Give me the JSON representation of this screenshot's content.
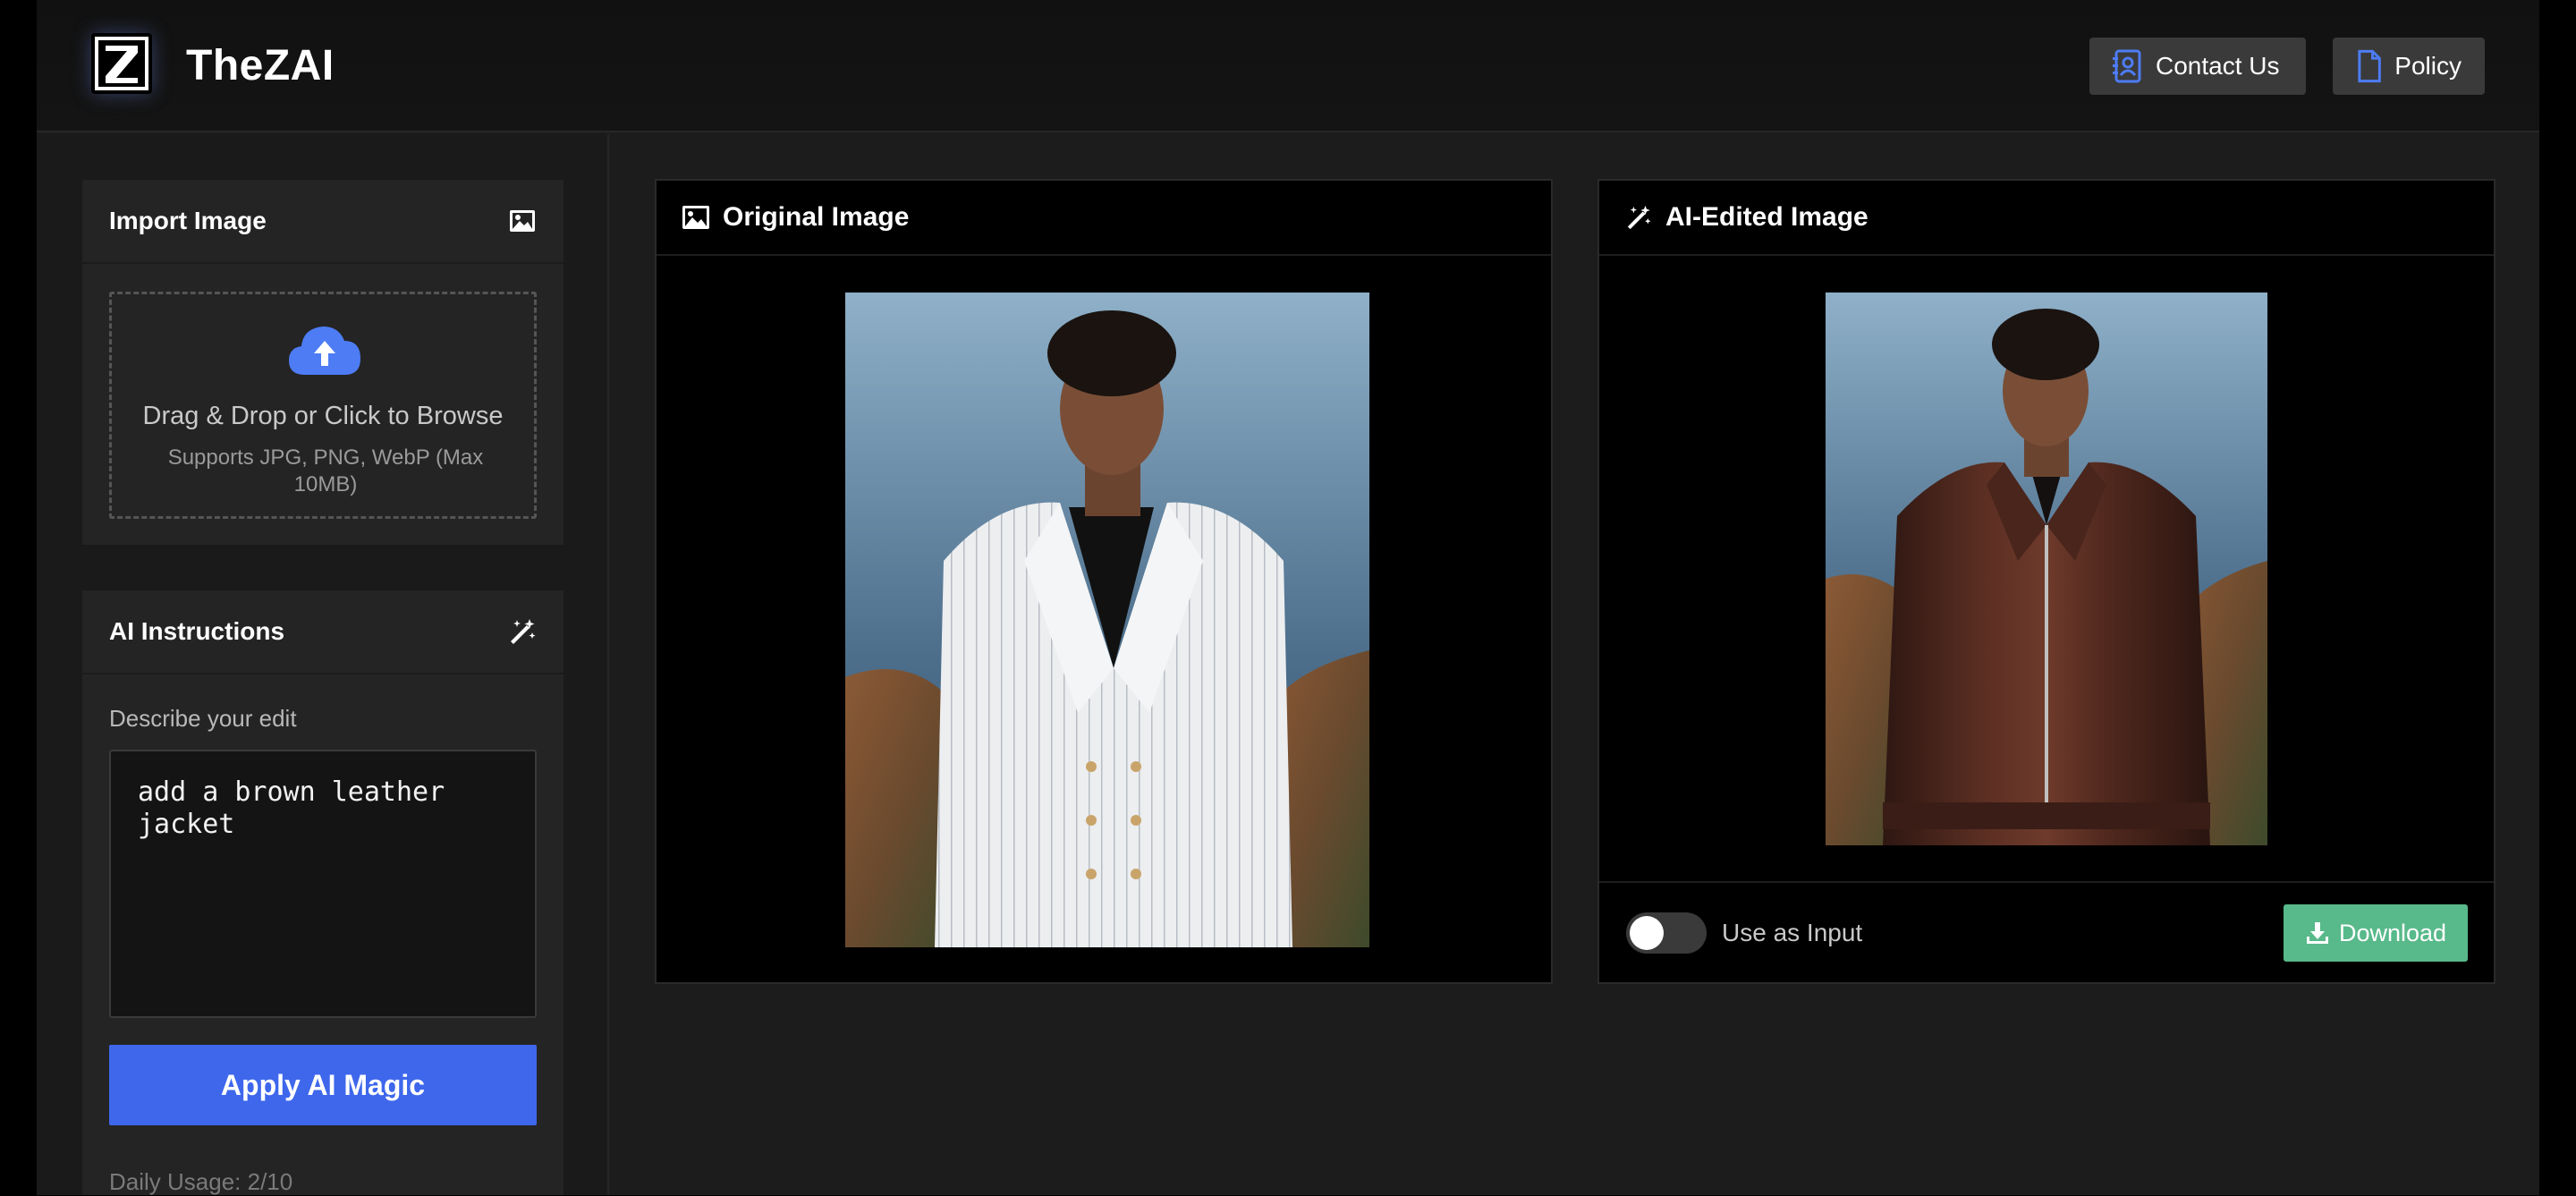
{
  "header": {
    "logo_text": "Z",
    "brand": "TheZAI",
    "contact_label": "Contact Us",
    "policy_label": "Policy"
  },
  "sidebar": {
    "import_panel": {
      "title": "Import Image",
      "drop_title": "Drag & Drop or Click to Browse",
      "drop_subtitle": "Supports JPG, PNG, WebP (Max 10MB)"
    },
    "ai_panel": {
      "title": "AI Instructions",
      "field_label": "Describe your edit",
      "prompt_value": "add a brown leather jacket",
      "apply_label": "Apply AI Magic",
      "usage_text": "Daily Usage: 2/10"
    }
  },
  "main": {
    "original_card": {
      "title": "Original Image",
      "image_icon": "image-icon"
    },
    "edited_card": {
      "title": "AI-Edited Image",
      "image_icon": "magic-wand-icon",
      "toggle_label": "Use as Input",
      "toggle_on": false,
      "download_label": "Download"
    }
  },
  "colors": {
    "accent_blue": "#3e67ec",
    "download_green": "#58b98a",
    "icon_blue": "#4d7cf5"
  }
}
